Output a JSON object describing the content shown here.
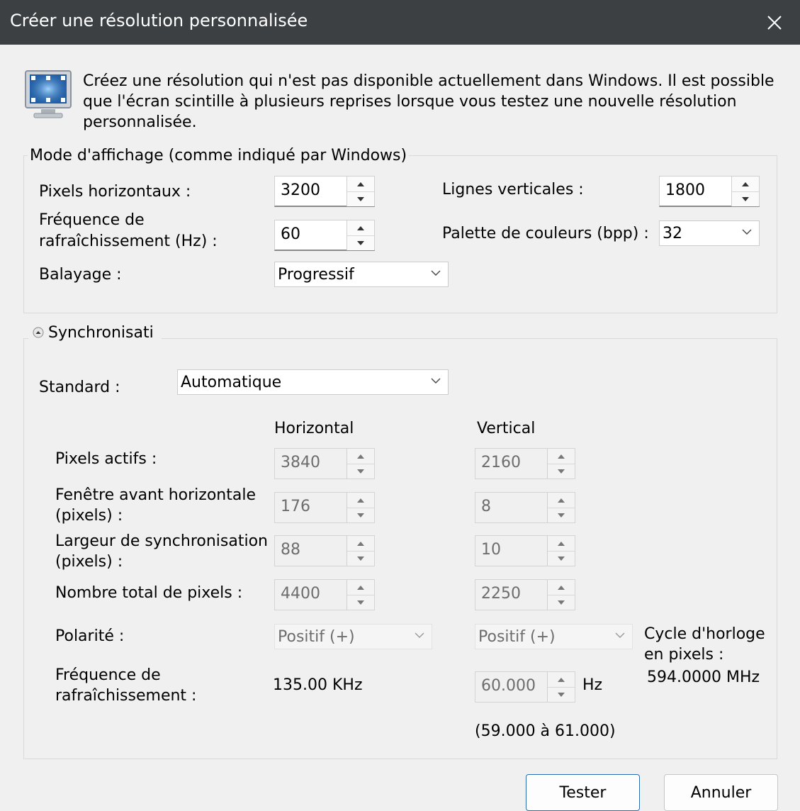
{
  "window": {
    "title": "Créer une résolution personnalisée",
    "close_icon": "close-icon"
  },
  "intro": {
    "icon": "monitor-icon",
    "text": "Créez une résolution qui n'est pas disponible actuellement dans Windows. Il est possible que l'écran scintille à plusieurs reprises lorsque vous testez une nouvelle résolution personnalisée."
  },
  "display_mode": {
    "legend": "Mode d'affichage (comme indiqué par Windows)",
    "horizontal_pixels": {
      "label": "Pixels horizontaux :",
      "value": "3200"
    },
    "vertical_lines": {
      "label": "Lignes verticales :",
      "value": "1800"
    },
    "refresh_rate": {
      "label_line1": "Fréquence de",
      "label_line2": "rafraîchissement (Hz) :",
      "value": "60"
    },
    "color_depth": {
      "label": "Palette de couleurs (bpp) :",
      "value": "32"
    },
    "scan": {
      "label": "Balayage :",
      "value": "Progressif"
    }
  },
  "timing": {
    "legend": "Synchronisati",
    "standard": {
      "label": "Standard :",
      "value": "Automatique"
    },
    "col_horizontal": "Horizontal",
    "col_vertical": "Vertical",
    "rows": {
      "active_pixels": {
        "label": "Pixels actifs :",
        "h": "3840",
        "v": "2160"
      },
      "front_porch": {
        "label_line1": "Fenêtre avant horizontale",
        "label_line2": "(pixels) :",
        "h": "176",
        "v": "8"
      },
      "sync_width": {
        "label_line1": "Largeur de synchronisation",
        "label_line2": "(pixels) :",
        "h": "88",
        "v": "10"
      },
      "total_pixels": {
        "label": "Nombre total de pixels :",
        "h": "4400",
        "v": "2250"
      }
    },
    "polarity": {
      "label": "Polarité :",
      "h": "Positif (+)",
      "v": "Positif (+)"
    },
    "refresh": {
      "label_line1": "Fréquence de",
      "label_line2": "rafraîchissement :",
      "h": "135.00 KHz",
      "v": "60.000",
      "v_unit": "Hz",
      "range": "(59.000 à 61.000)"
    },
    "pixel_clock": {
      "label_line1": "Cycle d'horloge",
      "label_line2": "en pixels :",
      "value": "594.0000 MHz"
    }
  },
  "buttons": {
    "test": "Tester",
    "cancel": "Annuler"
  }
}
